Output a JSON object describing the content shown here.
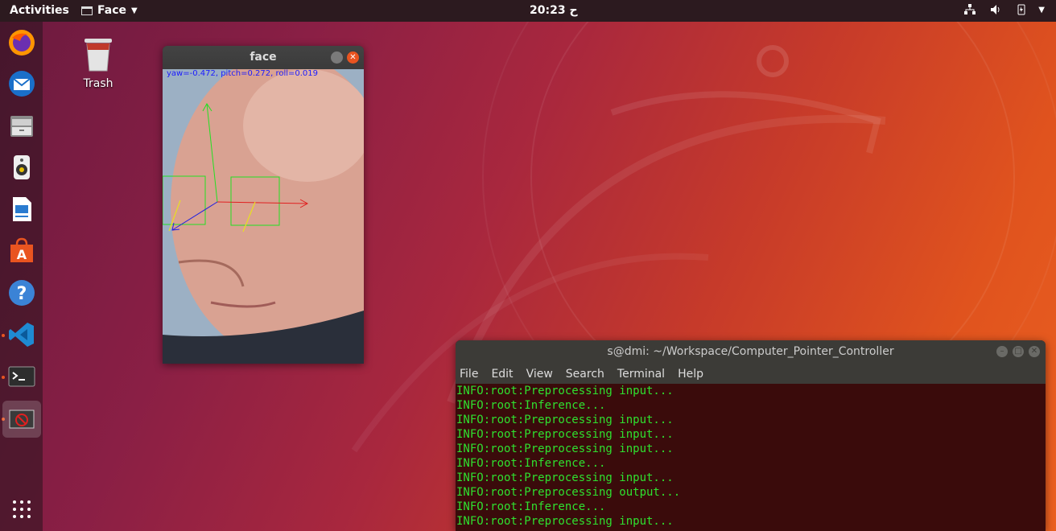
{
  "topbar": {
    "activities": "Activities",
    "app_name": "Face",
    "clock": "20:23 ح"
  },
  "dock": {
    "items": [
      {
        "name": "firefox-icon"
      },
      {
        "name": "thunderbird-icon"
      },
      {
        "name": "files-icon"
      },
      {
        "name": "rhythmbox-icon"
      },
      {
        "name": "libreoffice-writer-icon"
      },
      {
        "name": "software-icon"
      },
      {
        "name": "help-icon"
      },
      {
        "name": "vscode-icon"
      },
      {
        "name": "terminal-icon"
      },
      {
        "name": "face-window-icon"
      }
    ]
  },
  "desktop": {
    "trash_label": "Trash"
  },
  "face_window": {
    "title": "face",
    "readout": "yaw=-0.472, pitch=0.272, roll=0.019"
  },
  "terminal": {
    "title": "s@dmi: ~/Workspace/Computer_Pointer_Controller",
    "menu": [
      "File",
      "Edit",
      "View",
      "Search",
      "Terminal",
      "Help"
    ],
    "lines": [
      "INFO:root:Preprocessing input...",
      "INFO:root:Inference...",
      "INFO:root:Preprocessing input...",
      "INFO:root:Preprocessing input...",
      "INFO:root:Preprocessing input...",
      "INFO:root:Inference...",
      "INFO:root:Preprocessing input...",
      "INFO:root:Preprocessing output...",
      "INFO:root:Inference...",
      "INFO:root:Preprocessing input..."
    ]
  },
  "colors": {
    "accent": "#e95420",
    "terminal_text": "#2fe02f",
    "readout_text": "#1a1aff"
  }
}
